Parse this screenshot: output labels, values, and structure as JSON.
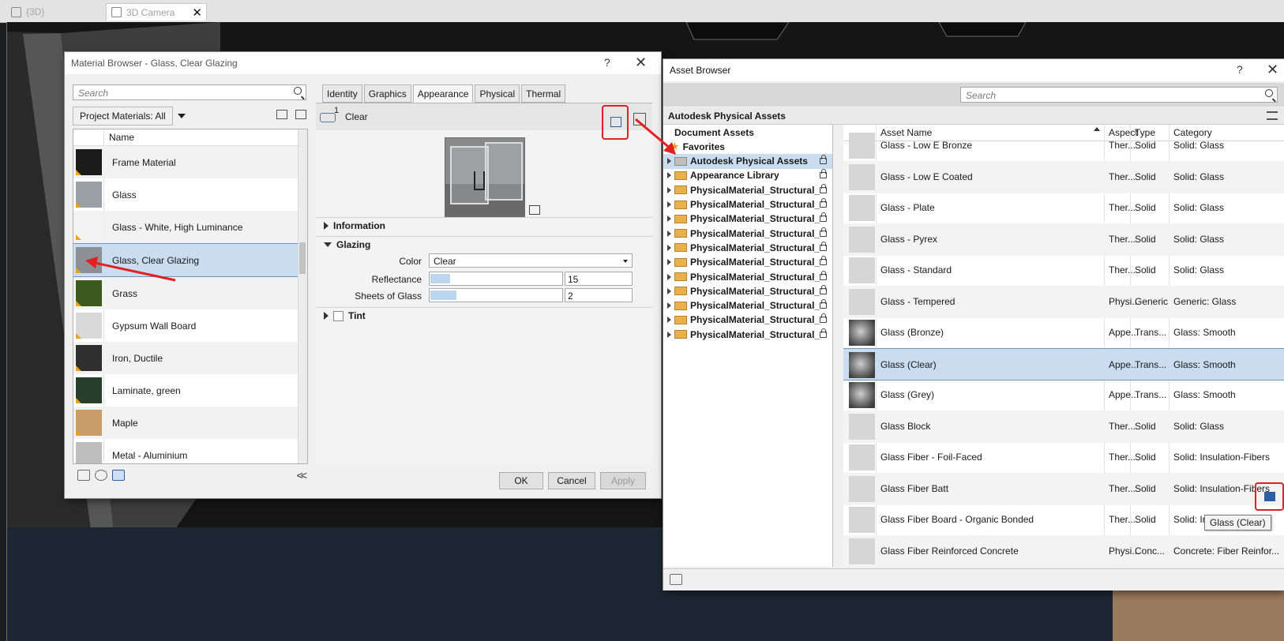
{
  "tabs": [
    {
      "label": "{3D}"
    },
    {
      "label": "3D Camera"
    }
  ],
  "material_browser": {
    "title": "Material Browser - Glass, Clear Glazing",
    "help": "?",
    "search_placeholder": "Search",
    "filter_label": "Project Materials: All",
    "list_header": "Name",
    "materials": [
      {
        "name": "Frame Material",
        "swatch": "#1b1b1b"
      },
      {
        "name": "Glass",
        "swatch": "#9aa0a6"
      },
      {
        "name": "Glass - White, High Luminance",
        "swatch": "#f4f4f4"
      },
      {
        "name": "Glass, Clear Glazing",
        "swatch": "#8c8f94"
      },
      {
        "name": "Grass",
        "swatch": "#3d5a1e"
      },
      {
        "name": "Gypsum Wall Board",
        "swatch": "#d9d9d9"
      },
      {
        "name": "Iron, Ductile",
        "swatch": "#2f2f2f"
      },
      {
        "name": "Laminate, green",
        "swatch": "#27402e"
      },
      {
        "name": "Maple",
        "swatch": "#c99b66"
      },
      {
        "name": "Metal - Aluminium",
        "swatch": "#bdbdbd"
      }
    ],
    "selected_index": 3,
    "editor_tabs": [
      "Identity",
      "Graphics",
      "Appearance",
      "Physical",
      "Thermal"
    ],
    "active_tab": "Appearance",
    "asset_count": "1",
    "asset_name": "Clear",
    "sections": {
      "information": "Information",
      "glazing": "Glazing",
      "tint": "Tint"
    },
    "properties": {
      "color_label": "Color",
      "color_value": "Clear",
      "reflectance_label": "Reflectance",
      "reflectance_value": "15",
      "reflectance_fraction": 0.15,
      "sheets_label": "Sheets of Glass",
      "sheets_value": "2",
      "sheets_fraction": 0.2
    },
    "buttons": {
      "ok": "OK",
      "cancel": "Cancel",
      "apply": "Apply"
    }
  },
  "asset_browser": {
    "title": "Asset Browser",
    "help": "?",
    "search_placeholder": "Search",
    "library_header": "Autodesk Physical Assets",
    "tree": [
      {
        "label": "Document Assets",
        "type": "root"
      },
      {
        "label": "Favorites",
        "type": "favorites"
      },
      {
        "label": "Autodesk Physical Assets",
        "type": "library-selected"
      },
      {
        "label": "Appearance Library",
        "type": "folder"
      },
      {
        "label": "PhysicalMaterial_Structural_...",
        "type": "folder"
      },
      {
        "label": "PhysicalMaterial_Structural_...",
        "type": "folder"
      },
      {
        "label": "PhysicalMaterial_Structural_...",
        "type": "folder"
      },
      {
        "label": "PhysicalMaterial_Structural_I...",
        "type": "folder"
      },
      {
        "label": "PhysicalMaterial_Structural_...",
        "type": "folder"
      },
      {
        "label": "PhysicalMaterial_Structural_...",
        "type": "folder"
      },
      {
        "label": "PhysicalMaterial_Structural_...",
        "type": "folder"
      },
      {
        "label": "PhysicalMaterial_Structural_...",
        "type": "folder"
      },
      {
        "label": "PhysicalMaterial_Structural_...",
        "type": "folder"
      },
      {
        "label": "PhysicalMaterial_Structural_...",
        "type": "folder"
      },
      {
        "label": "PhysicalMaterial_Structural_...",
        "type": "folder"
      }
    ],
    "columns": [
      "Asset Name",
      "Aspect",
      "Type",
      "Category"
    ],
    "assets": [
      {
        "name": "Glass - Low E Bronze",
        "aspect": "Ther...",
        "type": "Solid",
        "category": "Solid: Glass",
        "swatch": "plain"
      },
      {
        "name": "Glass - Low E Coated",
        "aspect": "Ther...",
        "type": "Solid",
        "category": "Solid: Glass",
        "swatch": "plain"
      },
      {
        "name": "Glass - Plate",
        "aspect": "Ther...",
        "type": "Solid",
        "category": "Solid: Glass",
        "swatch": "plain"
      },
      {
        "name": "Glass - Pyrex",
        "aspect": "Ther...",
        "type": "Solid",
        "category": "Solid: Glass",
        "swatch": "plain"
      },
      {
        "name": "Glass - Standard",
        "aspect": "Ther...",
        "type": "Solid",
        "category": "Solid: Glass",
        "swatch": "plain"
      },
      {
        "name": "Glass - Tempered",
        "aspect": "Physi...",
        "type": "Generic",
        "category": "Generic: Glass",
        "swatch": "plain"
      },
      {
        "name": "Glass (Bronze)",
        "aspect": "Appe...",
        "type": "Trans...",
        "category": "Glass: Smooth",
        "swatch": "glass"
      },
      {
        "name": "Glass (Clear)",
        "aspect": "Appe...",
        "type": "Trans...",
        "category": "Glass: Smooth",
        "swatch": "glass"
      },
      {
        "name": "Glass (Grey)",
        "aspect": "Appe...",
        "type": "Trans...",
        "category": "Glass: Smooth",
        "swatch": "glass"
      },
      {
        "name": "Glass Block",
        "aspect": "Ther...",
        "type": "Solid",
        "category": "Solid: Glass",
        "swatch": "plain"
      },
      {
        "name": "Glass Fiber - Foil-Faced",
        "aspect": "Ther...",
        "type": "Solid",
        "category": "Solid: Insulation-Fibers",
        "swatch": "plain"
      },
      {
        "name": "Glass Fiber Batt",
        "aspect": "Ther...",
        "type": "Solid",
        "category": "Solid: Insulation-Fibers",
        "swatch": "plain"
      },
      {
        "name": "Glass Fiber Board - Organic Bonded",
        "aspect": "Ther...",
        "type": "Solid",
        "category": "Solid: Insulation-Fibers",
        "swatch": "plain"
      },
      {
        "name": "Glass Fiber Reinforced Concrete",
        "aspect": "Physi...",
        "type": "Conc...",
        "category": "Concrete: Fiber Reinfor...",
        "swatch": "plain"
      }
    ],
    "selected_index": 7,
    "tooltip": "Glass (Clear)"
  },
  "colors": {
    "selection": "#c9dcf0",
    "annotation": "#e3201f",
    "viewport": "#151515"
  }
}
